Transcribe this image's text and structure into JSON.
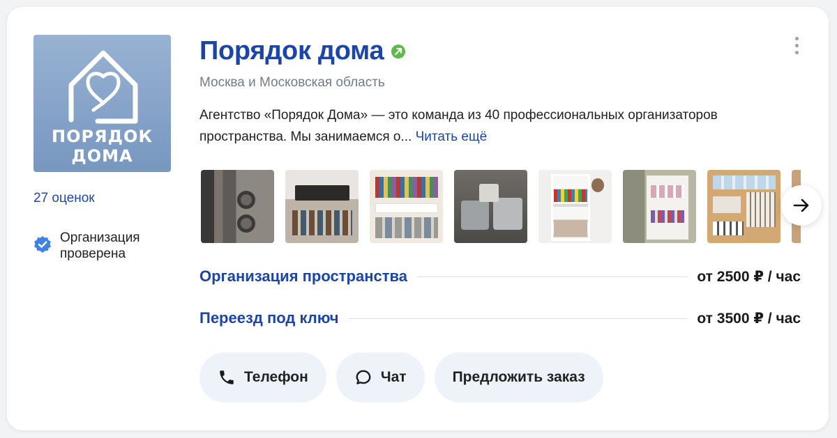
{
  "logo": {
    "line1": "ПОРЯДОК",
    "line2": "ДОМА",
    "bg_color": "#7f9dc6"
  },
  "reviews": {
    "label": "27 оценок"
  },
  "verified": {
    "label": "Организация проверена",
    "icon": "verified-badge-icon",
    "color": "#3d82e4"
  },
  "business": {
    "title": "Порядок дома",
    "title_badge_icon": "arrow-up-right-badge-icon",
    "region": "Москва и Московская область",
    "description": "Агентство «Порядок Дома» — это команда из 40 профессиональных организаторов пространства. Мы занимаемся о...",
    "read_more": "Читать ещё",
    "accent_color": "#1c45aa"
  },
  "gallery": {
    "count_visible": 8,
    "next_icon": "arrow-right-icon"
  },
  "services": [
    {
      "name": "Организация пространства",
      "price": "от 2500 ₽ / час"
    },
    {
      "name": "Переезд под ключ",
      "price": "от 3500 ₽ / час"
    }
  ],
  "actions": [
    {
      "label": "Телефон",
      "icon": "phone-icon"
    },
    {
      "label": "Чат",
      "icon": "chat-bubble-icon"
    },
    {
      "label": "Предложить заказ",
      "icon": ""
    }
  ]
}
